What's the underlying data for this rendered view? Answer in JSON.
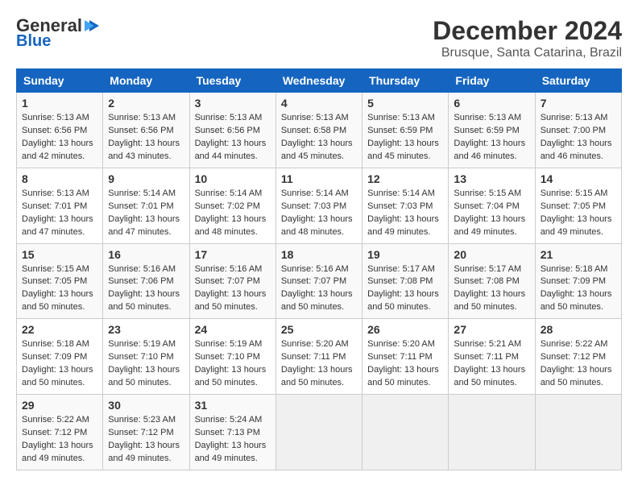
{
  "logo": {
    "general": "General",
    "blue": "Blue"
  },
  "title": "December 2024",
  "subtitle": "Brusque, Santa Catarina, Brazil",
  "days_header": [
    "Sunday",
    "Monday",
    "Tuesday",
    "Wednesday",
    "Thursday",
    "Friday",
    "Saturday"
  ],
  "weeks": [
    [
      {
        "day": "1",
        "info": "Sunrise: 5:13 AM\nSunset: 6:56 PM\nDaylight: 13 hours\nand 42 minutes."
      },
      {
        "day": "2",
        "info": "Sunrise: 5:13 AM\nSunset: 6:56 PM\nDaylight: 13 hours\nand 43 minutes."
      },
      {
        "day": "3",
        "info": "Sunrise: 5:13 AM\nSunset: 6:56 PM\nDaylight: 13 hours\nand 44 minutes."
      },
      {
        "day": "4",
        "info": "Sunrise: 5:13 AM\nSunset: 6:58 PM\nDaylight: 13 hours\nand 45 minutes."
      },
      {
        "day": "5",
        "info": "Sunrise: 5:13 AM\nSunset: 6:59 PM\nDaylight: 13 hours\nand 45 minutes."
      },
      {
        "day": "6",
        "info": "Sunrise: 5:13 AM\nSunset: 6:59 PM\nDaylight: 13 hours\nand 46 minutes."
      },
      {
        "day": "7",
        "info": "Sunrise: 5:13 AM\nSunset: 7:00 PM\nDaylight: 13 hours\nand 46 minutes."
      }
    ],
    [
      {
        "day": "8",
        "info": "Sunrise: 5:13 AM\nSunset: 7:01 PM\nDaylight: 13 hours\nand 47 minutes."
      },
      {
        "day": "9",
        "info": "Sunrise: 5:14 AM\nSunset: 7:01 PM\nDaylight: 13 hours\nand 47 minutes."
      },
      {
        "day": "10",
        "info": "Sunrise: 5:14 AM\nSunset: 7:02 PM\nDaylight: 13 hours\nand 48 minutes."
      },
      {
        "day": "11",
        "info": "Sunrise: 5:14 AM\nSunset: 7:03 PM\nDaylight: 13 hours\nand 48 minutes."
      },
      {
        "day": "12",
        "info": "Sunrise: 5:14 AM\nSunset: 7:03 PM\nDaylight: 13 hours\nand 49 minutes."
      },
      {
        "day": "13",
        "info": "Sunrise: 5:15 AM\nSunset: 7:04 PM\nDaylight: 13 hours\nand 49 minutes."
      },
      {
        "day": "14",
        "info": "Sunrise: 5:15 AM\nSunset: 7:05 PM\nDaylight: 13 hours\nand 49 minutes."
      }
    ],
    [
      {
        "day": "15",
        "info": "Sunrise: 5:15 AM\nSunset: 7:05 PM\nDaylight: 13 hours\nand 50 minutes."
      },
      {
        "day": "16",
        "info": "Sunrise: 5:16 AM\nSunset: 7:06 PM\nDaylight: 13 hours\nand 50 minutes."
      },
      {
        "day": "17",
        "info": "Sunrise: 5:16 AM\nSunset: 7:07 PM\nDaylight: 13 hours\nand 50 minutes."
      },
      {
        "day": "18",
        "info": "Sunrise: 5:16 AM\nSunset: 7:07 PM\nDaylight: 13 hours\nand 50 minutes."
      },
      {
        "day": "19",
        "info": "Sunrise: 5:17 AM\nSunset: 7:08 PM\nDaylight: 13 hours\nand 50 minutes."
      },
      {
        "day": "20",
        "info": "Sunrise: 5:17 AM\nSunset: 7:08 PM\nDaylight: 13 hours\nand 50 minutes."
      },
      {
        "day": "21",
        "info": "Sunrise: 5:18 AM\nSunset: 7:09 PM\nDaylight: 13 hours\nand 50 minutes."
      }
    ],
    [
      {
        "day": "22",
        "info": "Sunrise: 5:18 AM\nSunset: 7:09 PM\nDaylight: 13 hours\nand 50 minutes."
      },
      {
        "day": "23",
        "info": "Sunrise: 5:19 AM\nSunset: 7:10 PM\nDaylight: 13 hours\nand 50 minutes."
      },
      {
        "day": "24",
        "info": "Sunrise: 5:19 AM\nSunset: 7:10 PM\nDaylight: 13 hours\nand 50 minutes."
      },
      {
        "day": "25",
        "info": "Sunrise: 5:20 AM\nSunset: 7:11 PM\nDaylight: 13 hours\nand 50 minutes."
      },
      {
        "day": "26",
        "info": "Sunrise: 5:20 AM\nSunset: 7:11 PM\nDaylight: 13 hours\nand 50 minutes."
      },
      {
        "day": "27",
        "info": "Sunrise: 5:21 AM\nSunset: 7:11 PM\nDaylight: 13 hours\nand 50 minutes."
      },
      {
        "day": "28",
        "info": "Sunrise: 5:22 AM\nSunset: 7:12 PM\nDaylight: 13 hours\nand 50 minutes."
      }
    ],
    [
      {
        "day": "29",
        "info": "Sunrise: 5:22 AM\nSunset: 7:12 PM\nDaylight: 13 hours\nand 49 minutes."
      },
      {
        "day": "30",
        "info": "Sunrise: 5:23 AM\nSunset: 7:12 PM\nDaylight: 13 hours\nand 49 minutes."
      },
      {
        "day": "31",
        "info": "Sunrise: 5:24 AM\nSunset: 7:13 PM\nDaylight: 13 hours\nand 49 minutes."
      },
      {
        "day": "",
        "info": ""
      },
      {
        "day": "",
        "info": ""
      },
      {
        "day": "",
        "info": ""
      },
      {
        "day": "",
        "info": ""
      }
    ]
  ]
}
